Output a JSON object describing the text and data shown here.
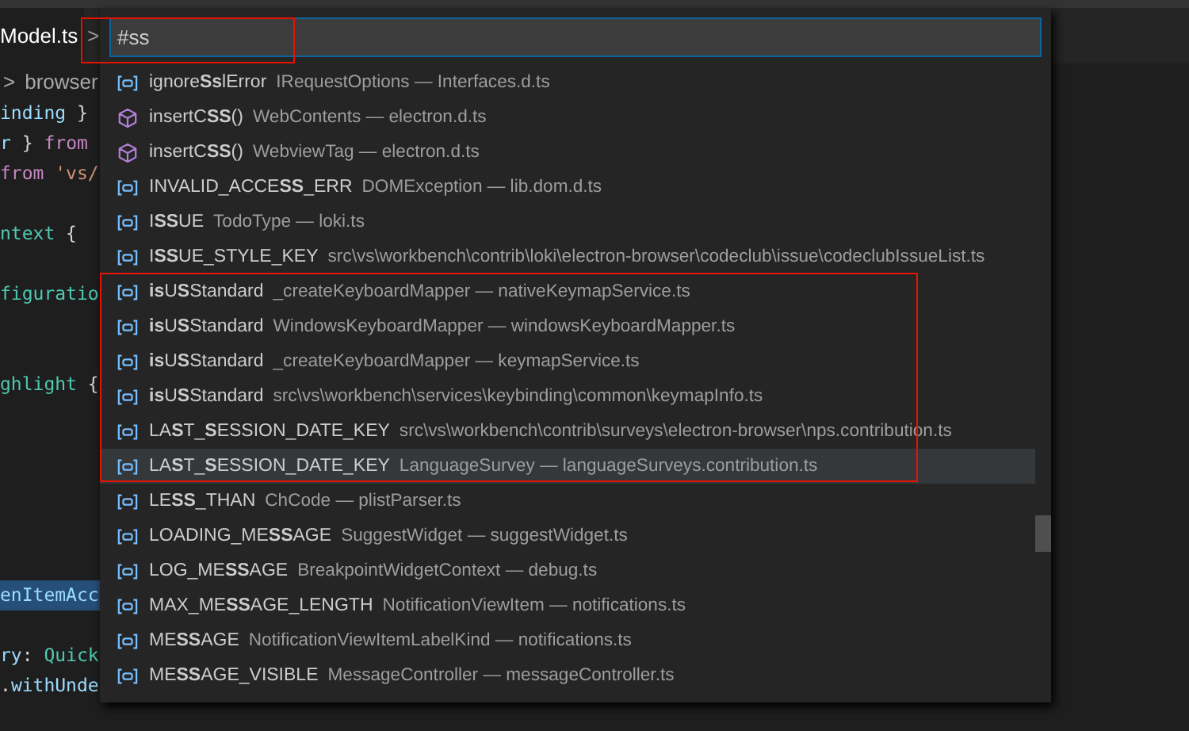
{
  "tab": {
    "label": "Model.ts",
    "selected": true
  },
  "tab_chevron": ">",
  "breadcrumb": {
    "chevron": ">",
    "label": "browser"
  },
  "code_lines": [
    {
      "kind": "code",
      "highlighted": false,
      "tokens": [
        {
          "kind": "variable",
          "text": "inding"
        },
        {
          "kind": "plain",
          "text": " }"
        }
      ]
    },
    {
      "kind": "code",
      "highlighted": false,
      "tokens": [
        {
          "kind": "variable",
          "text": "r"
        },
        {
          "kind": "plain",
          "text": " } "
        },
        {
          "kind": "keyword",
          "text": "from"
        }
      ]
    },
    {
      "kind": "code",
      "highlighted": false,
      "tokens": [
        {
          "kind": "keyword",
          "text": "from "
        },
        {
          "kind": "string",
          "text": "'vs/"
        }
      ]
    },
    {
      "kind": "blank"
    },
    {
      "kind": "code",
      "highlighted": false,
      "tokens": [
        {
          "kind": "type",
          "text": "ntext"
        },
        {
          "kind": "plain",
          "text": " {"
        }
      ]
    },
    {
      "kind": "blank"
    },
    {
      "kind": "code",
      "highlighted": false,
      "tokens": [
        {
          "kind": "type",
          "text": "figuratio"
        }
      ]
    },
    {
      "kind": "blank"
    },
    {
      "kind": "blank"
    },
    {
      "kind": "code",
      "highlighted": false,
      "tokens": [
        {
          "kind": "type",
          "text": "ghlight"
        },
        {
          "kind": "plain",
          "text": " {"
        }
      ]
    },
    {
      "kind": "blank"
    },
    {
      "kind": "blank"
    },
    {
      "kind": "blank"
    },
    {
      "kind": "blank"
    },
    {
      "kind": "blank"
    },
    {
      "kind": "blank"
    },
    {
      "kind": "code",
      "highlighted": true,
      "tokens": [
        {
          "kind": "variable",
          "text": "enItemAcc"
        }
      ]
    },
    {
      "kind": "blank"
    },
    {
      "kind": "code",
      "highlighted": false,
      "tokens": [
        {
          "kind": "variable",
          "text": "ry"
        },
        {
          "kind": "plain",
          "text": ": "
        },
        {
          "kind": "type",
          "text": "Quick"
        }
      ]
    },
    {
      "kind": "code",
      "highlighted": false,
      "tokens": [
        {
          "kind": "plain",
          "text": "."
        },
        {
          "kind": "variable",
          "text": "withUnde"
        }
      ]
    }
  ],
  "quick_open": {
    "input": {
      "value": "#ss"
    },
    "results": [
      {
        "kind": "field",
        "label": "ignore**Ss**lError",
        "description": "IRequestOptions — Interfaces.d.ts",
        "selected": false
      },
      {
        "kind": "method",
        "label": "insertC**SS**()",
        "description": "WebContents — electron.d.ts",
        "selected": false
      },
      {
        "kind": "method",
        "label": "insertC**SS**()",
        "description": "WebviewTag — electron.d.ts",
        "selected": false
      },
      {
        "kind": "field",
        "label": "INVALID_ACCE**SS**_ERR",
        "description": "DOMException — lib.dom.d.ts",
        "selected": false
      },
      {
        "kind": "field",
        "label": "I**SS**UE",
        "description": "TodoType — loki.ts",
        "selected": false
      },
      {
        "kind": "field",
        "label": "I**SS**UE_STYLE_KEY",
        "description": "src\\vs\\workbench\\contrib\\loki\\electron-browser\\codeclub\\issue\\codeclubIssueList.ts",
        "selected": false
      },
      {
        "kind": "field",
        "label": "**is**U**S**Standard",
        "description": "_createKeyboardMapper — nativeKeymapService.ts",
        "selected": false
      },
      {
        "kind": "field",
        "label": "**is**U**S**Standard",
        "description": "WindowsKeyboardMapper — windowsKeyboardMapper.ts",
        "selected": false
      },
      {
        "kind": "field",
        "label": "**is**U**S**Standard",
        "description": "_createKeyboardMapper — keymapService.ts",
        "selected": false
      },
      {
        "kind": "field",
        "label": "**is**U**S**Standard",
        "description": "src\\vs\\workbench\\services\\keybinding\\common\\keymapInfo.ts",
        "selected": false
      },
      {
        "kind": "field",
        "label": "LA**S**T_**S**ESSION_DATE_KEY",
        "description": "src\\vs\\workbench\\contrib\\surveys\\electron-browser\\nps.contribution.ts",
        "selected": false
      },
      {
        "kind": "field",
        "label": "LA**S**T_**S**ESSION_DATE_KEY",
        "description": "LanguageSurvey — languageSurveys.contribution.ts",
        "selected": true
      },
      {
        "kind": "field",
        "label": "LE**SS**_THAN",
        "description": "ChCode — plistParser.ts",
        "selected": false
      },
      {
        "kind": "field",
        "label": "LOADING_ME**SS**AGE",
        "description": "SuggestWidget — suggestWidget.ts",
        "selected": false
      },
      {
        "kind": "field",
        "label": "LOG_ME**SS**AGE",
        "description": "BreakpointWidgetContext — debug.ts",
        "selected": false
      },
      {
        "kind": "field",
        "label": "MAX_ME**SS**AGE_LENGTH",
        "description": "NotificationViewItem — notifications.ts",
        "selected": false
      },
      {
        "kind": "field",
        "label": "ME**SS**AGE",
        "description": "NotificationViewItemLabelKind — notifications.ts",
        "selected": false
      },
      {
        "kind": "field",
        "label": "ME**SS**AGE_VISIBLE",
        "description": "MessageController — messageController.ts",
        "selected": false
      }
    ]
  }
}
